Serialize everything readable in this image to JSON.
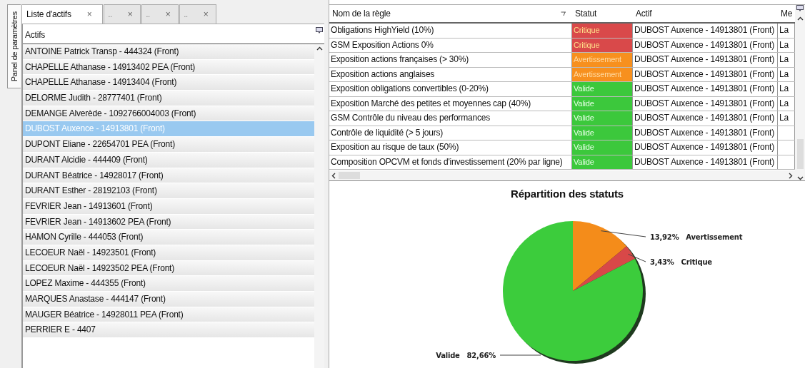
{
  "side_tab": {
    "label": "Panel de paramètres"
  },
  "tabs": [
    {
      "label": "Liste d'actifs",
      "close": "×",
      "selected": true
    },
    {
      "label": "..",
      "close": "×",
      "selected": false
    },
    {
      "label": "..",
      "close": "×",
      "selected": false
    },
    {
      "label": "..",
      "close": "×",
      "selected": false
    }
  ],
  "asset_list": {
    "header": "Actifs",
    "items": [
      {
        "label": "ANTOINE Patrick Transp - 444324 (Front)",
        "selected": false
      },
      {
        "label": "CHAPELLE Athanase - 14913402 PEA (Front)",
        "selected": false
      },
      {
        "label": "CHAPELLE Athanase - 14913404 (Front)",
        "selected": false
      },
      {
        "label": "DELORME Judith - 28777401 (Front)",
        "selected": false
      },
      {
        "label": "DEMANGE Alverède - 1092766004003 (Front)",
        "selected": false
      },
      {
        "label": "DUBOST Auxence - 14913801 (Front)",
        "selected": true
      },
      {
        "label": "DUPONT Eliane - 22654701 PEA (Front)",
        "selected": false
      },
      {
        "label": "DURANT Alcidie - 444409 (Front)",
        "selected": false
      },
      {
        "label": "DURANT Béatrice - 14928017 (Front)",
        "selected": false
      },
      {
        "label": "DURANT Esther - 28192103 (Front)",
        "selected": false
      },
      {
        "label": "FEVRIER Jean - 14913601 (Front)",
        "selected": false
      },
      {
        "label": "FEVRIER Jean - 14913602 PEA (Front)",
        "selected": false
      },
      {
        "label": "HAMON Cyrille - 444053 (Front)",
        "selected": false
      },
      {
        "label": "LECOEUR Naël - 14923501 (Front)",
        "selected": false
      },
      {
        "label": "LECOEUR Naël - 14923502 PEA (Front)",
        "selected": false
      },
      {
        "label": "LOPEZ Maxime - 444355 (Front)",
        "selected": false
      },
      {
        "label": "MARQUES Anastase - 444147 (Front)",
        "selected": false
      },
      {
        "label": "MAUGER Béatrice - 14928011 PEA (Front)",
        "selected": false
      },
      {
        "label": "PERRIER E - 4407",
        "selected": false
      }
    ]
  },
  "rules_table": {
    "columns": [
      "Nom de la règle",
      "Statut",
      "Actif",
      "Me"
    ],
    "rows": [
      {
        "rule": "Obligations HighYield (10%)",
        "status": "Critique",
        "kind": "critical",
        "asset": "DUBOST Auxence - 14913801 (Front)",
        "column_4": "La"
      },
      {
        "rule": "GSM Exposition Actions 0%",
        "status": "Critique",
        "kind": "critical",
        "asset": "DUBOST Auxence - 14913801 (Front)",
        "column_4": "La"
      },
      {
        "rule": "Exposition actions françaises (> 30%)",
        "status": "Avertissement",
        "kind": "warning",
        "asset": "DUBOST Auxence - 14913801 (Front)",
        "column_4": "La"
      },
      {
        "rule": "Exposition actions anglaises",
        "status": "Avertissement",
        "kind": "warning",
        "asset": "DUBOST Auxence - 14913801 (Front)",
        "column_4": "La"
      },
      {
        "rule": "Exposition obligations convertibles (0-20%)",
        "status": "Valide",
        "kind": "valid",
        "asset": "DUBOST Auxence - 14913801 (Front)",
        "column_4": "La"
      },
      {
        "rule": "Exposition Marché des petites et moyennes cap (40%)",
        "status": "Valide",
        "kind": "valid",
        "asset": "DUBOST Auxence - 14913801 (Front)",
        "column_4": "La"
      },
      {
        "rule": "GSM Contrôle du niveau des performances",
        "status": "Valide",
        "kind": "valid",
        "asset": "DUBOST Auxence - 14913801 (Front)",
        "column_4": "La"
      },
      {
        "rule": "Contrôle de liquidité (> 5 jours)",
        "status": "Valide",
        "kind": "valid",
        "asset": "DUBOST Auxence - 14913801 (Front)"
      },
      {
        "rule": "Exposition au risque de taux (50%)",
        "status": "Valide",
        "kind": "valid",
        "asset": "DUBOST Auxence - 14913801 (Front)"
      },
      {
        "rule": "Composition OPCVM et fonds d'investissement (20% par ligne)",
        "status": "Valide",
        "kind": "valid",
        "asset": "DUBOST Auxence - 14913801 (Front)"
      }
    ]
  },
  "status_chart": {
    "chart_data": {
      "type": "pie",
      "title": "Répartition des statuts",
      "categories": [
        "Avertissement",
        "Critique",
        "Valide"
      ],
      "values": [
        13.92,
        3.43,
        82.66
      ],
      "value_labels": [
        "13,92%",
        "3,43%",
        "82,66%"
      ]
    }
  }
}
